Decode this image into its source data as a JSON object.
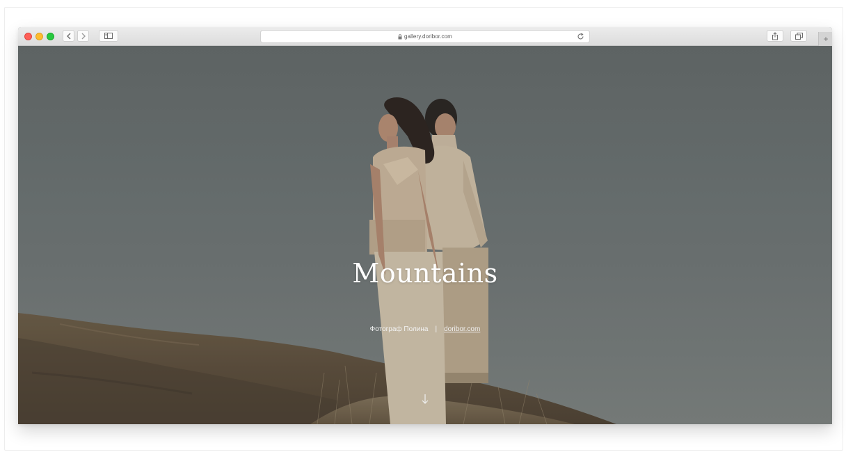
{
  "browser": {
    "url": "gallery.doribor.com",
    "new_tab_label": "+"
  },
  "hero": {
    "title": "Mountains",
    "photographer": "Фотограф Полина",
    "separator": "|",
    "link": "doribor.com"
  },
  "colors": {
    "traffic_red": "#fe5f57",
    "traffic_yellow": "#febc2e",
    "traffic_green": "#28c840",
    "sky": "#6f7676",
    "hill": "#6a5a44"
  },
  "icons": {
    "back": "chevron-left-icon",
    "forward": "chevron-right-icon",
    "sidebar": "sidebar-icon",
    "lock": "lock-icon",
    "reload": "reload-icon",
    "share": "share-icon",
    "tabs": "tabs-icon",
    "scroll": "arrow-down-icon"
  }
}
